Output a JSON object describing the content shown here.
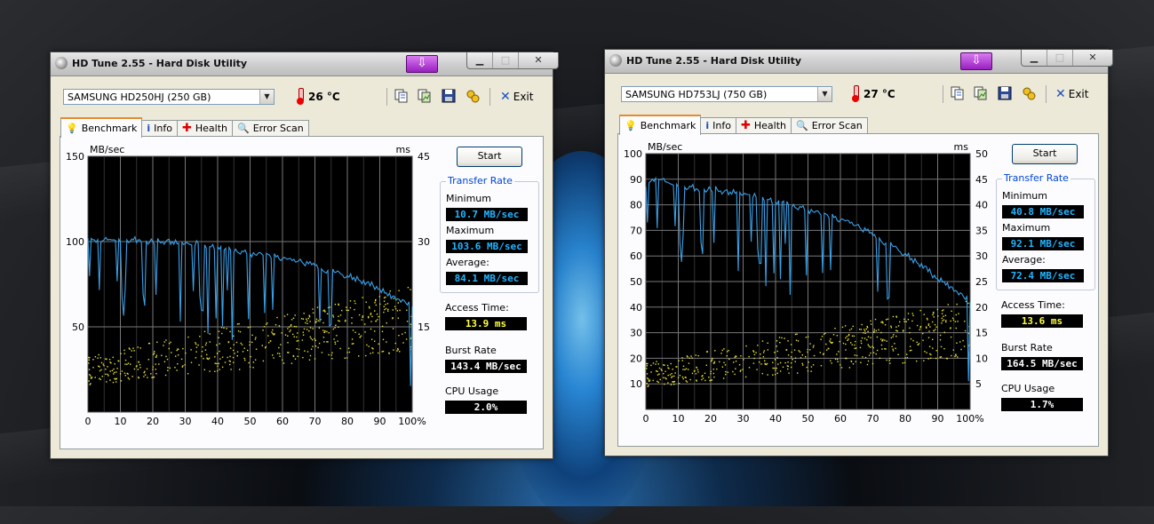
{
  "windows": [
    {
      "id": "left",
      "title": "HD Tune 2.55 - Hard Disk Utility",
      "drive": "SAMSUNG HD250HJ (250 GB)",
      "temperature": "26 °C",
      "exit_label": "Exit",
      "tabs": [
        {
          "label": "Benchmark",
          "icon": "benchmark-icon",
          "active": true
        },
        {
          "label": "Info",
          "icon": "info-icon",
          "active": false
        },
        {
          "label": "Health",
          "icon": "health-icon",
          "active": false
        },
        {
          "label": "Error Scan",
          "icon": "error-scan-icon",
          "active": false
        }
      ],
      "start_label": "Start",
      "transfer_rate_label": "Transfer Rate",
      "minimum_label": "Minimum",
      "minimum": "10.7 MB/sec",
      "maximum_label": "Maximum",
      "maximum": "103.6 MB/sec",
      "average_label": "Average:",
      "average": "84.1 MB/sec",
      "access_time_label": "Access Time:",
      "access_time": "13.9 ms",
      "burst_rate_label": "Burst Rate",
      "burst_rate": "143.4 MB/sec",
      "cpu_usage_label": "CPU Usage",
      "cpu_usage": "2.0%",
      "chart_data": {
        "type": "line",
        "left_unit": "MB/sec",
        "right_unit": "ms",
        "ylim": [
          0,
          150
        ],
        "y2lim": [
          0,
          45
        ],
        "yticks": [
          50,
          100,
          150
        ],
        "y2ticks": [
          15,
          30,
          45
        ],
        "xlim": [
          0,
          100
        ],
        "xticks": [
          "0",
          "10",
          "20",
          "30",
          "40",
          "50",
          "60",
          "70",
          "80",
          "90",
          "100%"
        ],
        "grid": true,
        "series": [
          {
            "role": "transfer-rate",
            "color": "#3aa0e8",
            "x": [
              0,
              2,
              4,
              6,
              8,
              10,
              12,
              14,
              16,
              18,
              20,
              22,
              24,
              26,
              28,
              30,
              32,
              34,
              36,
              38,
              40,
              42,
              44,
              46,
              48,
              50,
              52,
              54,
              56,
              58,
              60,
              62,
              64,
              66,
              68,
              70,
              72,
              74,
              76,
              78,
              80,
              82,
              84,
              86,
              88,
              90,
              92,
              94,
              96,
              98,
              100
            ],
            "y": [
              102,
              101,
              100,
              101,
              101,
              100,
              101,
              101,
              101,
              100,
              100,
              100,
              100,
              100,
              99,
              99,
              98,
              99,
              98,
              97,
              97,
              95,
              95,
              94,
              94,
              93,
              92,
              92,
              92,
              91,
              90,
              90,
              88,
              88,
              87,
              86,
              84,
              83,
              82,
              81,
              80,
              79,
              77,
              76,
              74,
              72,
              70,
              68,
              66,
              64,
              62
            ]
          },
          {
            "role": "access-time",
            "color": "#e8e030",
            "x": [
              0,
              10,
              20,
              30,
              40,
              50,
              60,
              70,
              80,
              90,
              100
            ],
            "y": [
              7.5,
              8.4,
              9.3,
              10.2,
              11.1,
              12.0,
              12.9,
              13.8,
              14.7,
              15.6,
              16.5
            ]
          }
        ]
      }
    },
    {
      "id": "right",
      "title": "HD Tune 2.55 - Hard Disk Utility",
      "drive": "SAMSUNG HD753LJ (750 GB)",
      "temperature": "27 °C",
      "exit_label": "Exit",
      "tabs": [
        {
          "label": "Benchmark",
          "icon": "benchmark-icon",
          "active": true
        },
        {
          "label": "Info",
          "icon": "info-icon",
          "active": false
        },
        {
          "label": "Health",
          "icon": "health-icon",
          "active": false
        },
        {
          "label": "Error Scan",
          "icon": "error-scan-icon",
          "active": false
        }
      ],
      "start_label": "Start",
      "transfer_rate_label": "Transfer Rate",
      "minimum_label": "Minimum",
      "minimum": "40.8 MB/sec",
      "maximum_label": "Maximum",
      "maximum": "92.1 MB/sec",
      "average_label": "Average:",
      "average": "72.4 MB/sec",
      "access_time_label": "Access Time:",
      "access_time": "13.6 ms",
      "burst_rate_label": "Burst Rate",
      "burst_rate": "164.5 MB/sec",
      "cpu_usage_label": "CPU Usage",
      "cpu_usage": "1.7%",
      "chart_data": {
        "type": "line",
        "left_unit": "MB/sec",
        "right_unit": "ms",
        "ylim": [
          0,
          100
        ],
        "y2lim": [
          0,
          50
        ],
        "yticks": [
          10,
          20,
          30,
          40,
          50,
          60,
          70,
          80,
          90,
          100
        ],
        "y2ticks": [
          5,
          10,
          15,
          20,
          25,
          30,
          35,
          40,
          45,
          50
        ],
        "xlim": [
          0,
          100
        ],
        "xticks": [
          "0",
          "10",
          "20",
          "30",
          "40",
          "50",
          "60",
          "70",
          "80",
          "90",
          "100%"
        ],
        "grid": true,
        "series": [
          {
            "role": "transfer-rate",
            "color": "#3aa0e8",
            "x": [
              0,
              2,
              4,
              6,
              8,
              10,
              12,
              14,
              16,
              18,
              20,
              22,
              24,
              26,
              28,
              30,
              32,
              34,
              36,
              38,
              40,
              42,
              44,
              46,
              48,
              50,
              52,
              54,
              56,
              58,
              60,
              62,
              64,
              66,
              68,
              70,
              72,
              74,
              76,
              78,
              80,
              82,
              84,
              86,
              88,
              90,
              92,
              94,
              96,
              98,
              100
            ],
            "y": [
              87,
              90,
              90,
              89,
              88,
              87,
              87,
              87,
              86,
              86,
              86,
              86,
              85,
              85,
              85,
              84,
              84,
              83,
              83,
              82,
              81,
              81,
              80,
              79,
              79,
              78,
              77,
              76,
              76,
              75,
              74,
              74,
              72,
              71,
              70,
              68,
              67,
              65,
              64,
              62,
              61,
              59,
              57,
              56,
              53,
              51,
              50,
              48,
              46,
              44,
              42
            ]
          },
          {
            "role": "access-time",
            "color": "#e8e030",
            "x": [
              0,
              10,
              20,
              30,
              40,
              50,
              60,
              70,
              80,
              90,
              100
            ],
            "y": [
              7.0,
              7.8,
              8.7,
              9.6,
              10.5,
              11.4,
              12.3,
              13.2,
              14.1,
              15.0,
              15.9
            ]
          }
        ]
      }
    }
  ]
}
